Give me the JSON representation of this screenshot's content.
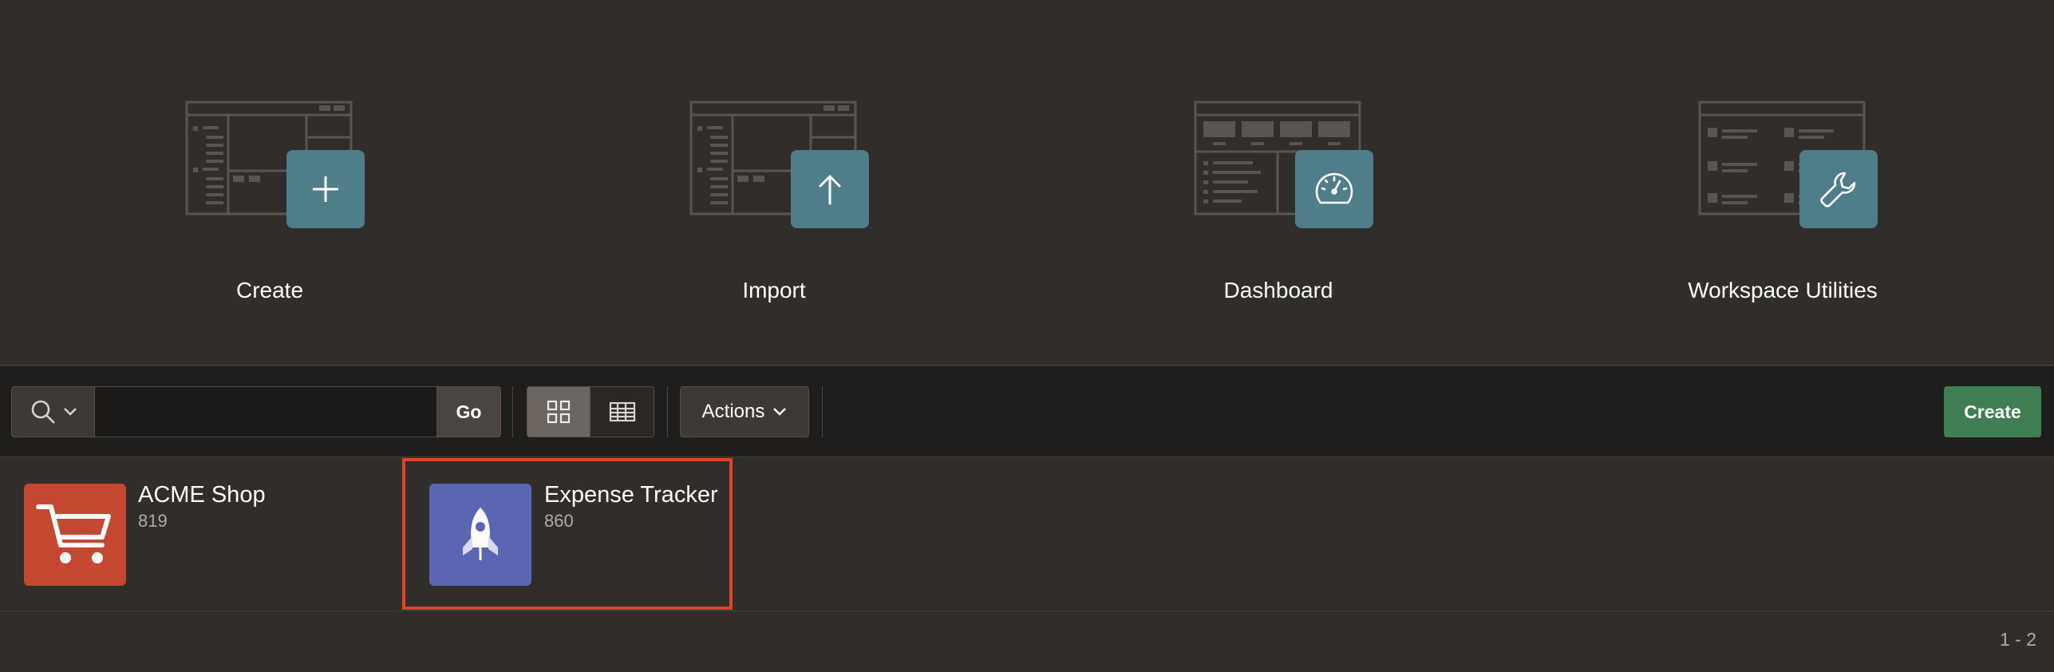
{
  "hero": {
    "cards": [
      {
        "label": "Create",
        "icon": "plus-icon"
      },
      {
        "label": "Import",
        "icon": "upload-arrow-icon"
      },
      {
        "label": "Dashboard",
        "icon": "gauge-icon"
      },
      {
        "label": "Workspace Utilities",
        "icon": "wrench-icon"
      }
    ]
  },
  "toolbar": {
    "search_placeholder": "",
    "search_value": "",
    "go_label": "Go",
    "actions_label": "Actions",
    "create_label": "Create"
  },
  "apps": [
    {
      "name": "ACME Shop",
      "id": "819",
      "icon": "shopping-cart-icon",
      "color": "#c4472f"
    },
    {
      "name": "Expense Tracker",
      "id": "860",
      "icon": "rocket-icon",
      "color": "#5b66b3",
      "selected": true
    }
  ],
  "pager": {
    "range": "1 - 2"
  },
  "colors": {
    "background": "#312d2a",
    "toolbar": "#201e1c",
    "badge": "#4f7d8a",
    "create_button": "#3f7e53",
    "selection": "#e0452b"
  }
}
